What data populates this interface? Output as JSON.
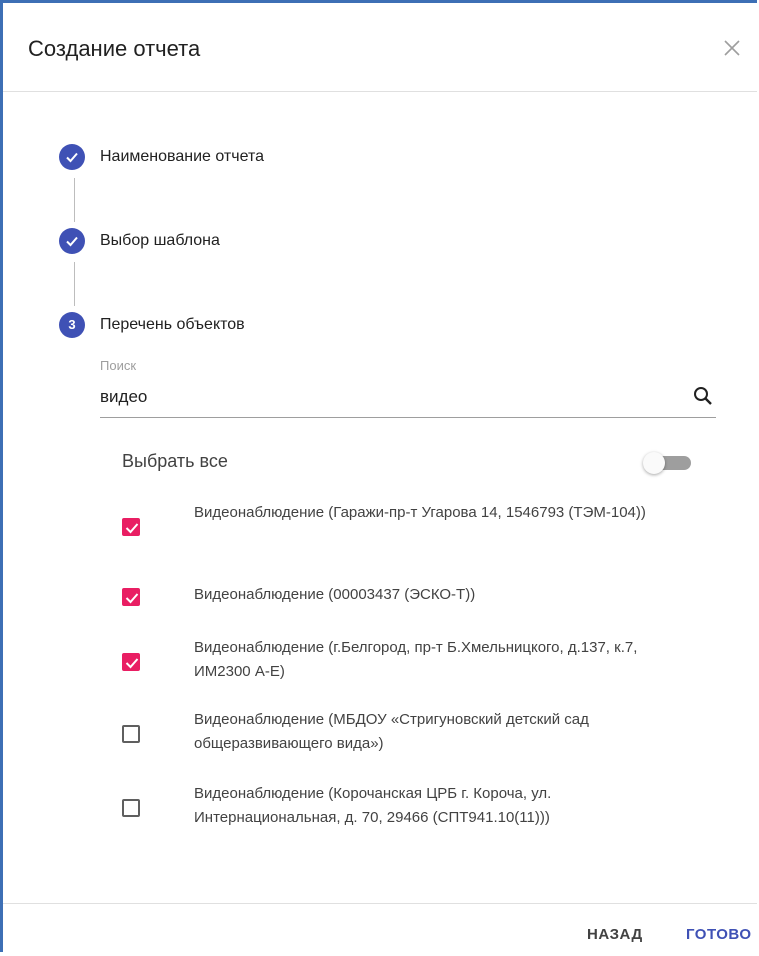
{
  "dialog": {
    "title": "Создание отчета",
    "close_icon": "close-icon"
  },
  "steps": [
    {
      "number": "1",
      "label": "Наименование отчета",
      "status": "completed",
      "icon": "check-icon"
    },
    {
      "number": "2",
      "label": "Выбор шаблона",
      "status": "completed",
      "icon": "check-icon"
    },
    {
      "number": "3",
      "label": "Перечень объектов",
      "status": "active"
    }
  ],
  "search": {
    "label": "Поиск",
    "value": "видео",
    "icon": "search-icon"
  },
  "select_all": {
    "label": "Выбрать все",
    "enabled": false
  },
  "items": [
    {
      "label": "Видеонаблюдение (Гаражи-пр-т Угарова 14, 1546793 (ТЭМ-104))",
      "checked": true
    },
    {
      "label": "Видеонаблюдение (00003437 (ЭСКО-Т))",
      "checked": true
    },
    {
      "label": "Видеонаблюдение (г.Белгород, пр-т Б.Хмельницкого, д.137, к.7, ИМ2300 А-Е)",
      "checked": true
    },
    {
      "label": "Видеонаблюдение (МБДОУ «Стригуновский детский сад общеразвивающего вида»)",
      "checked": false
    },
    {
      "label": "Видеонаблюдение (Корочанская ЦРБ г. Короча, ул. Интернациональная, д. 70, 29466 (СПТ941.10(11)))",
      "checked": false
    }
  ],
  "footer": {
    "back_label": "НАЗАД",
    "done_label": "ГОТОВО"
  },
  "colors": {
    "primary": "#3f51b5",
    "accent": "#e91e63",
    "dialog_border": "#3d6fb5"
  }
}
